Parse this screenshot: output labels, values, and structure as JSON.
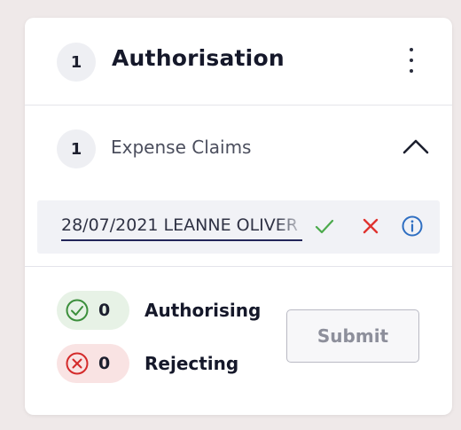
{
  "header": {
    "count": "1",
    "title": "Authorisation"
  },
  "section": {
    "count": "1",
    "title": "Expense Claims"
  },
  "claim": {
    "text": "28/07/2021 LEANNE OLIVER"
  },
  "summary": {
    "authorising_count": "0",
    "authorising_label": "Authorising",
    "rejecting_count": "0",
    "rejecting_label": "Rejecting"
  },
  "submit_label": "Submit",
  "colors": {
    "approve": "#4caa4c",
    "reject": "#e0332f",
    "info": "#2f6fc2",
    "submit_disabled_text": "#8d8f9b"
  },
  "icons": {
    "more": "more-vertical-icon",
    "chevron": "chevron-up-icon",
    "approve": "check-icon",
    "reject": "close-icon",
    "info": "info-icon",
    "authorising": "check-circle-icon",
    "rejecting": "x-circle-icon"
  }
}
